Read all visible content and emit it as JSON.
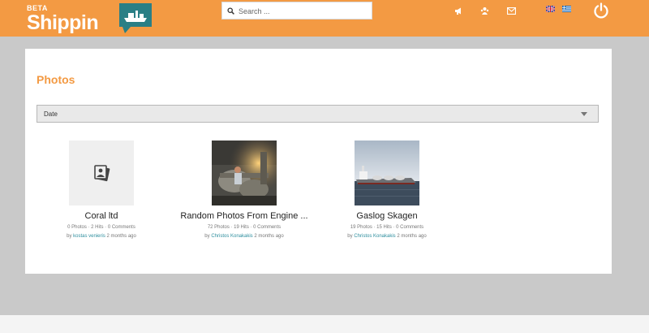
{
  "header": {
    "beta_label": "BETA",
    "brand_name": "Shippin",
    "search_placeholder": "Search ...",
    "brand_color": "#f39a43",
    "icons": [
      "megaphone-icon",
      "crowd-icon",
      "envelope-icon",
      "uk-flag-icon",
      "greek-flag-icon",
      "power-icon"
    ]
  },
  "main": {
    "title": "Photos",
    "sort": {
      "selected": "Date"
    },
    "albums": [
      {
        "title": "Coral ltd",
        "meta": "0 Photos · 2 Hits · 0 Comments",
        "by_prefix": "by",
        "author": "kostas venieris",
        "time": "2 months ago",
        "thumbnail": "placeholder-photos-icon"
      },
      {
        "title": "Random Photos From Engine ...",
        "meta": "72 Photos · 19 Hits · 0 Comments",
        "by_prefix": "by",
        "author": "Christos Konakakis",
        "time": "2 months ago",
        "thumbnail": "engine-room-photo"
      },
      {
        "title": "Gaslog Skagen",
        "meta": "19 Photos · 15 Hits · 0 Comments",
        "by_prefix": "by",
        "author": "Christos Konakakis",
        "time": "2 months ago",
        "thumbnail": "ship-at-sea-photo"
      }
    ]
  }
}
